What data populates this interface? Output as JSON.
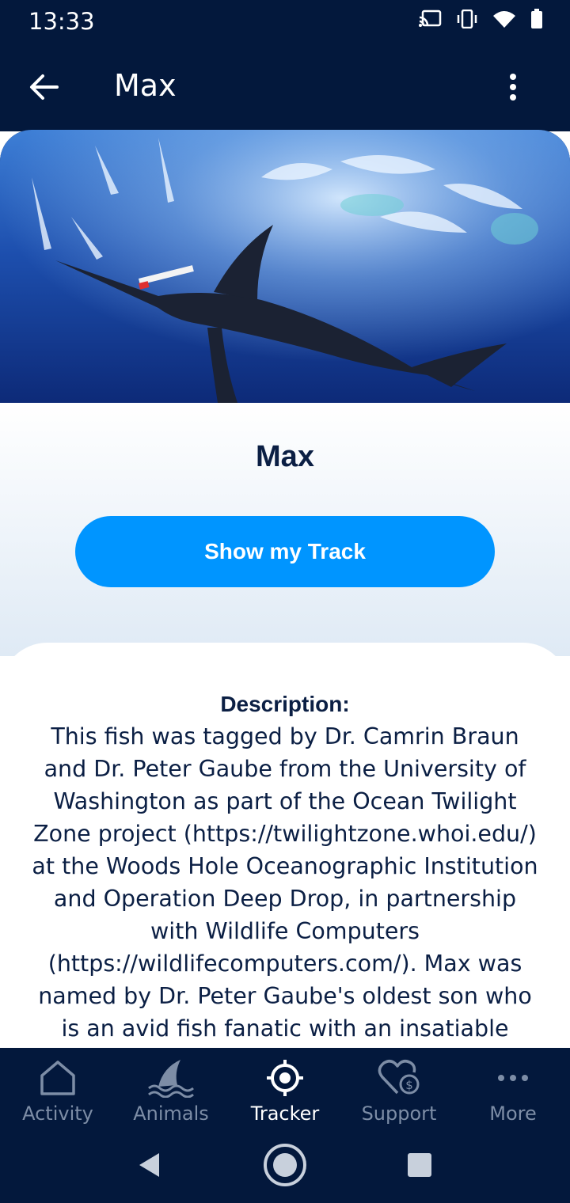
{
  "status_bar": {
    "time": "13:33",
    "icons": [
      "cast-icon",
      "vibrate-icon",
      "wifi-icon",
      "battery-icon"
    ]
  },
  "app_bar": {
    "title": "Max",
    "back_icon": "back-arrow-icon",
    "menu_icon": "more-vert-icon"
  },
  "hero_image": {
    "subject": "marlin-underwater-photo"
  },
  "profile": {
    "name": "Max",
    "track_button_label": "Show my Track"
  },
  "description": {
    "heading": "Description:",
    "body": "This fish was tagged by Dr. Camrin Braun and Dr. Peter Gaube from the University of Washington as part of the Ocean Twilight Zone project (https://twilightzone.whoi.edu/) at the Woods Hole Oceanographic Institution and Operation Deep Drop, in partnership with Wildlife Computers (https://wildlifecomputers.com/). Max was named by Dr. Peter Gaube's oldest son who is an avid fish fanatic with an insatiable interest in the oceans. For more"
  },
  "bottom_nav": {
    "items": [
      {
        "label": "Activity",
        "icon": "home-icon",
        "active": false
      },
      {
        "label": "Animals",
        "icon": "shark-fin-icon",
        "active": false
      },
      {
        "label": "Tracker",
        "icon": "crosshair-icon",
        "active": true
      },
      {
        "label": "Support",
        "icon": "heart-dollar-icon",
        "active": false
      },
      {
        "label": "More",
        "icon": "more-horiz-icon",
        "active": false
      }
    ]
  },
  "system_nav": {
    "buttons": [
      "back-triangle-icon",
      "home-circle-icon",
      "recents-square-icon"
    ]
  },
  "colors": {
    "navy": "#03183c",
    "accent": "#0095ff",
    "text_dark": "#0b1f44",
    "nav_inactive": "#7d8da6"
  }
}
